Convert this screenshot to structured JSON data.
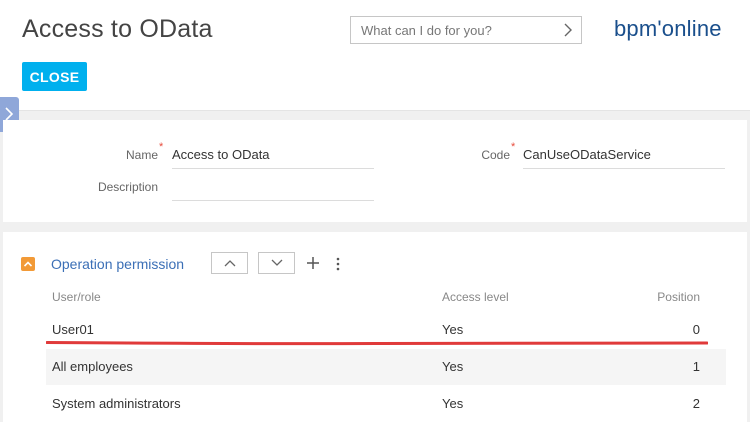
{
  "header": {
    "title": "Access to OData",
    "close_label": "CLOSE",
    "search_placeholder": "What can I do for you?",
    "logo_text": "bpm'online"
  },
  "form": {
    "name_label": "Name",
    "name_value": "Access to OData",
    "code_label": "Code",
    "code_value": "CanUseODataService",
    "description_label": "Description",
    "description_value": "",
    "required_mark": "*"
  },
  "permissions": {
    "title": "Operation permission",
    "columns": {
      "user_role": "User/role",
      "access_level": "Access level",
      "position": "Position"
    },
    "rows": [
      {
        "user_role": "User01",
        "access_level": "Yes",
        "position": "0"
      },
      {
        "user_role": "All employees",
        "access_level": "Yes",
        "position": "1"
      },
      {
        "user_role": "System administrators",
        "access_level": "Yes",
        "position": "2"
      }
    ]
  },
  "colors": {
    "accent": "#00b0ee",
    "section_title": "#3b6fb6",
    "collapse": "#f29a37",
    "annotation": "#e03a3a",
    "logo": "#1a4f8c"
  },
  "icons": [
    "chevron-right-icon",
    "chevron-up-icon",
    "chevron-down-icon",
    "plus-icon",
    "more-vertical-icon"
  ]
}
